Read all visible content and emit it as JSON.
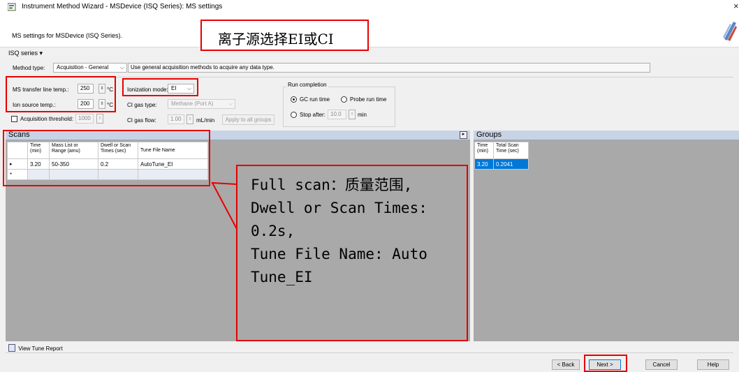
{
  "window": {
    "title": "Instrument Method Wizard - MSDevice (ISQ Series): MS settings",
    "close_glyph": "×"
  },
  "header": {
    "subtitle": "MS settings for MSDevice (ISQ Series)."
  },
  "series_menu": "ISQ series ▾",
  "method_type": {
    "label": "Method type:",
    "value": "Acquisition - General",
    "description": "Use general acquisition methods to acquire any data type."
  },
  "temps": {
    "transfer_label": "MS transfer line temp.:",
    "transfer_value": "250",
    "source_label": "Ion source temp.:",
    "source_value": "200",
    "unit": "°C"
  },
  "acq_threshold": {
    "label": "Acquisition threshold:",
    "value": "1000"
  },
  "ionization": {
    "label": "Ionization mode:",
    "value": "EI"
  },
  "ci": {
    "gas_type_label": "CI gas type:",
    "gas_type_value": "Methane (Port A)",
    "gas_flow_label": "CI gas flow:",
    "gas_flow_value": "1.00",
    "gas_flow_unit": "mL/min",
    "apply_button": "Apply to all groups"
  },
  "run_completion": {
    "title": "Run completion",
    "gc_run_time": "GC run time",
    "probe_run_time": "Probe run time",
    "stop_after": "Stop after:",
    "stop_value": "10.0",
    "stop_unit": "min"
  },
  "scans": {
    "title": "Scans",
    "columns": [
      {
        "line1": "Time",
        "line2": "(min)"
      },
      {
        "line1": "Mass List or",
        "line2": "Range (amu)"
      },
      {
        "line1": "Dwell or Scan",
        "line2": "Times (sec)"
      },
      {
        "line1": "Tune File Name",
        "line2": ""
      }
    ],
    "row": {
      "marker": "▸",
      "time": "3.20",
      "mass": "50-350",
      "dwell": "0.2",
      "tune": "AutoTune_EI"
    },
    "new_row_marker": "*"
  },
  "groups": {
    "title": "Groups",
    "columns": [
      {
        "line1": "Time",
        "line2": "(min)"
      },
      {
        "line1": "Total Scan",
        "line2": "Time (sec)"
      }
    ],
    "row": {
      "time": "3.20",
      "total": "0.2041"
    }
  },
  "view_tune_report": "View Tune Report",
  "buttons": {
    "back": "< Back",
    "next": "Next >",
    "cancel": "Cancel",
    "help": "Help"
  },
  "annotations": {
    "ion_source_note": "离子源选择EI或CI",
    "callout_lines": [
      "Full scan：质量范围,",
      "Dwell or Scan Times:",
      "0.2s,",
      "Tune File Name:  Auto",
      "Tune_EI"
    ]
  },
  "colors": {
    "annotation_red": "#e60000",
    "panel_gray": "#a9a9a9",
    "panel_header": "#c9d3e6",
    "selection_blue": "#0078d7"
  }
}
